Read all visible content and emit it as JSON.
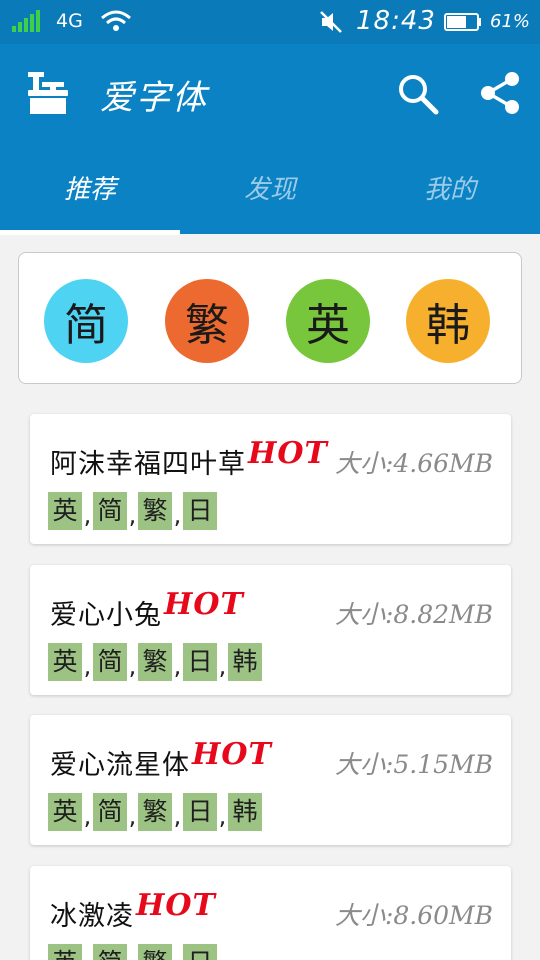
{
  "status_bar": {
    "network": "4G",
    "time": "18:43",
    "battery": "61%"
  },
  "app_bar": {
    "title": "爱字体"
  },
  "tabs": [
    {
      "label": "推荐",
      "active": true
    },
    {
      "label": "发现",
      "active": false
    },
    {
      "label": "我的",
      "active": false
    }
  ],
  "language_filters": [
    "简",
    "繁",
    "英",
    "韩"
  ],
  "fonts": [
    {
      "name": "阿沫幸福四叶草",
      "hot": "HOT",
      "size": "大小:4.66MB",
      "tags": [
        "英",
        "简",
        "繁",
        "日"
      ]
    },
    {
      "name": "爱心小兔",
      "hot": "HOT",
      "size": "大小:8.82MB",
      "tags": [
        "英",
        "简",
        "繁",
        "日",
        "韩"
      ]
    },
    {
      "name": "爱心流星体",
      "hot": "HOT",
      "size": "大小:5.15MB",
      "tags": [
        "英",
        "简",
        "繁",
        "日",
        "韩"
      ]
    },
    {
      "name": "冰激凌",
      "hot": "HOT",
      "size": "大小:8.60MB",
      "tags": [
        "英",
        "简",
        "繁",
        "日"
      ]
    }
  ],
  "colors": {
    "primary": "#0b82c4",
    "hot": "#e8081c",
    "tag_bg": "#9cc383",
    "simplified": "#4fd3f3",
    "traditional": "#ec6a2f",
    "english": "#78c63c",
    "korean": "#f6b02e"
  }
}
